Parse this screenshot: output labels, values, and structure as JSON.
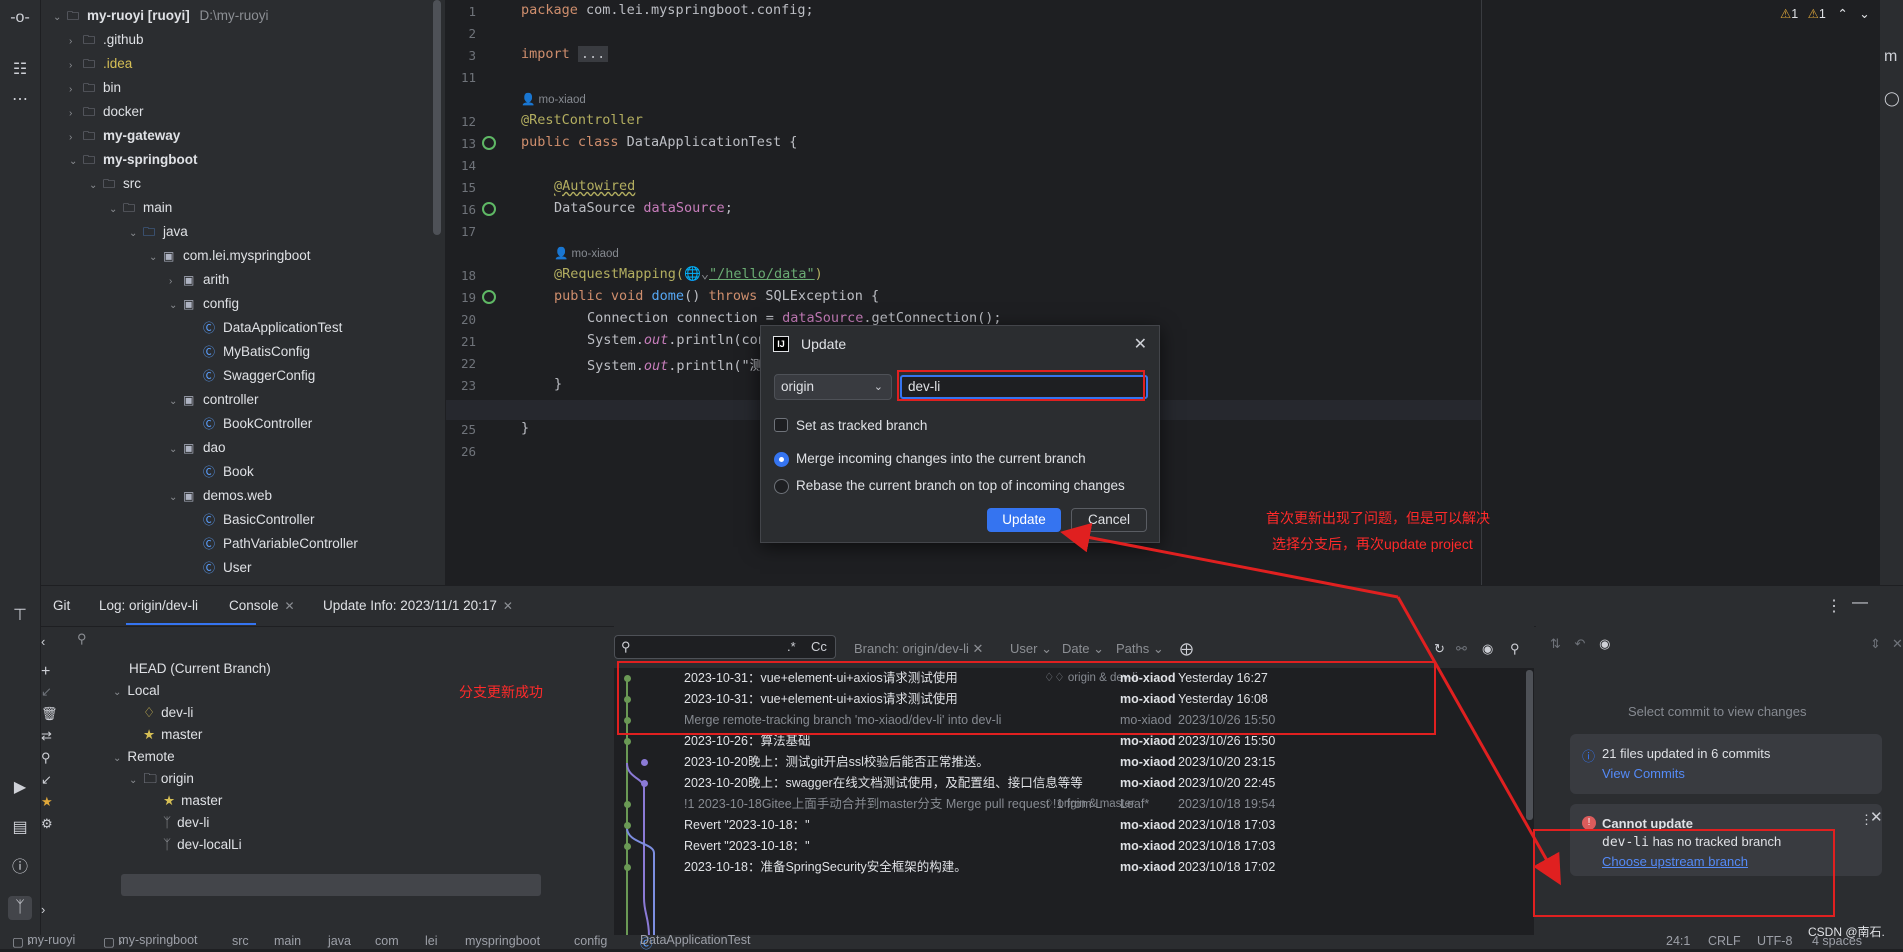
{
  "project_tree": {
    "root": {
      "name": "my-ruoyi [ruoyi]",
      "path": "D:\\my-ruoyi"
    },
    "items": [
      {
        "label": ".github",
        "kind": "folder"
      },
      {
        "label": ".idea",
        "kind": "folder"
      },
      {
        "label": "bin",
        "kind": "folder"
      },
      {
        "label": "docker",
        "kind": "folder"
      },
      {
        "label": "my-gateway",
        "kind": "module"
      },
      {
        "label": "my-springboot",
        "kind": "module"
      },
      {
        "label": "src",
        "kind": "folder"
      },
      {
        "label": "main",
        "kind": "folder"
      },
      {
        "label": "java",
        "kind": "folder"
      },
      {
        "label": "com.lei.myspringboot",
        "kind": "package"
      },
      {
        "label": "arith",
        "kind": "package"
      },
      {
        "label": "config",
        "kind": "package"
      },
      {
        "label": "DataApplicationTest",
        "kind": "class"
      },
      {
        "label": "MyBatisConfig",
        "kind": "class"
      },
      {
        "label": "SwaggerConfig",
        "kind": "class"
      },
      {
        "label": "controller",
        "kind": "package"
      },
      {
        "label": "BookController",
        "kind": "class"
      },
      {
        "label": "dao",
        "kind": "package"
      },
      {
        "label": "Book",
        "kind": "class"
      },
      {
        "label": "demos.web",
        "kind": "package"
      },
      {
        "label": "BasicController",
        "kind": "class"
      },
      {
        "label": "PathVariableController",
        "kind": "class"
      },
      {
        "label": "User",
        "kind": "class"
      }
    ]
  },
  "editor": {
    "warnings": [
      "1",
      "1"
    ],
    "line_numbers": [
      "1",
      "2",
      "3",
      "11",
      "12",
      "13",
      "14",
      "15",
      "16",
      "17",
      "18",
      "19",
      "20",
      "21",
      "22",
      "23",
      "24",
      "25",
      "26"
    ],
    "author": "mo-xiaod",
    "code": {
      "l1_kw": "package",
      "l1_rest": " com.lei.myspringboot.config;",
      "l3_kw": "import",
      "l3_fold": "...",
      "l12": "@RestController",
      "l13_kw": "public class",
      "l13_rest": " DataApplicationTest {",
      "l15": "@Autowired",
      "l16_type": "DataSource ",
      "l16_field": "dataSource",
      "l16_end": ";",
      "l18_ann": "@RequestMapping(",
      "l18_str": "\"/hello/data\"",
      "l18_end": ")",
      "l19_kw": "public void ",
      "l19_fn": "dome",
      "l19_mid": "() ",
      "l19_kw2": "throws",
      "l19_rest": " SQLException {",
      "l20_a": "Connection connection = ",
      "l20_b": "dataSource",
      "l20_c": ".getConnection();",
      "l21_a": "System.",
      "l21_b": "out",
      "l21_c": ".println(con",
      "l22_a": "System.",
      "l22_b": "out",
      "l22_c": ".println(\"测",
      "l23": "}",
      "l25": "}"
    }
  },
  "update_dialog": {
    "title": "Update",
    "remote": "origin",
    "branch": "dev-li",
    "tracked_label": "Set as tracked branch",
    "merge_label": "Merge incoming changes into the current branch",
    "rebase_label": "Rebase the current branch on top of incoming changes",
    "update_btn": "Update",
    "cancel_btn": "Cancel"
  },
  "annotations": {
    "note1_line1": "首次更新出现了问题，但是可以解决",
    "note1_line2": "选择分支后，再次update project",
    "note2": "分支更新成功"
  },
  "bottom": {
    "tabs": {
      "git": "Git",
      "log": "Log: origin/dev-li",
      "console": "Console",
      "update_info": "Update Info: 2023/11/1 20:17"
    },
    "branches": {
      "head": "HEAD (Current Branch)",
      "local": "Local",
      "local_items": [
        "dev-li",
        "master"
      ],
      "remote": "Remote",
      "origin": "origin",
      "remote_items": [
        "master",
        "dev-li",
        "dev-localLi"
      ]
    },
    "log_toolbar": {
      "regex": ".*",
      "case": "Cc",
      "branch": "Branch: origin/dev-li",
      "user": "User",
      "date": "Date",
      "paths": "Paths"
    },
    "commits": [
      {
        "msg": "2023-10-31：vue+element-ui+axios请求测试使用",
        "ref": "origin & dev-li",
        "author": "mo-xiaod",
        "date": "Yesterday 16:27",
        "dim": false
      },
      {
        "msg": "2023-10-31：vue+element-ui+axios请求测试使用",
        "ref": "",
        "author": "mo-xiaod",
        "date": "Yesterday 16:08",
        "dim": false
      },
      {
        "msg": "Merge remote-tracking branch 'mo-xiaod/dev-li' into dev-li",
        "ref": "",
        "author": "mo-xiaod",
        "date": "2023/10/26 15:50",
        "dim": true
      },
      {
        "msg": "2023-10-26：算法基础",
        "ref": "",
        "author": "mo-xiaod",
        "date": "2023/10/26 15:50",
        "dim": false
      },
      {
        "msg": "2023-10-20晚上：测试git开启ssl校验后能否正常推送。",
        "ref": "",
        "author": "mo-xiaod",
        "date": "2023/10/20 23:15",
        "dim": false
      },
      {
        "msg": "2023-10-20晚上：swagger在线文档测试使用，及配置组、接口信息等等",
        "ref": "",
        "author": "mo-xiaod",
        "date": "2023/10/20 22:45",
        "dim": false
      },
      {
        "msg": "!1 2023-10-18Gitee上面手动合并到master分支 Merge pull request !1 from L",
        "ref": "origin & master",
        "author": "Leaf*",
        "date": "2023/10/18 19:54",
        "dim": true
      },
      {
        "msg": "Revert \"2023-10-18：\"",
        "ref": "",
        "author": "mo-xiaod",
        "date": "2023/10/18 17:03",
        "dim": false
      },
      {
        "msg": "Revert \"2023-10-18：\"",
        "ref": "",
        "author": "mo-xiaod",
        "date": "2023/10/18 17:03",
        "dim": false
      },
      {
        "msg": "2023-10-18：准备SpringSecurity安全框架的构建。",
        "ref": "",
        "author": "mo-xiaod",
        "date": "2023/10/18 17:02",
        "dim": false
      }
    ],
    "changes": {
      "empty_text": "Select commit to view changes",
      "notif1_text": "21 files updated in 6 commits",
      "notif1_link": "View Commits",
      "notif2_title": "Cannot update",
      "notif2_branch": "dev-li",
      "notif2_text": " has no tracked branch",
      "notif2_link": "Choose upstream branch"
    }
  },
  "statusbar": {
    "crumbs": [
      "my-ruoyi",
      "my-springboot",
      "src",
      "main",
      "java",
      "com",
      "lei",
      "myspringboot",
      "config",
      "DataApplicationTest"
    ],
    "position": "24:1",
    "line_sep": "CRLF",
    "encoding": "UTF-8",
    "indent": "4 spaces",
    "watermark": "CSDN @南石."
  }
}
